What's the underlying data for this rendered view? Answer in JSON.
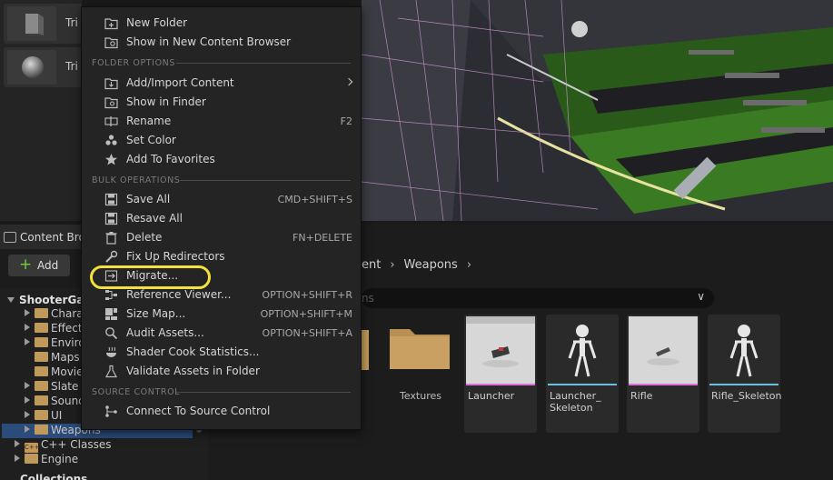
{
  "place_panel": {
    "items": [
      {
        "label": "Tri"
      },
      {
        "label": "Tri"
      }
    ]
  },
  "context_menu": {
    "items": [
      {
        "label": "New Folder",
        "icon": "new-folder-icon",
        "shortcut": ""
      },
      {
        "label": "Show in New Content Browser",
        "icon": "content-browser-icon",
        "shortcut": ""
      }
    ],
    "sections": [
      {
        "title": "FOLDER OPTIONS",
        "items": [
          {
            "label": "Add/Import Content",
            "icon": "import-icon",
            "shortcut": "",
            "submenu": true
          },
          {
            "label": "Show in Finder",
            "icon": "finder-icon",
            "shortcut": ""
          },
          {
            "label": "Rename",
            "icon": "rename-icon",
            "shortcut": "F2"
          },
          {
            "label": "Set Color",
            "icon": "palette-icon",
            "shortcut": ""
          },
          {
            "label": "Add To Favorites",
            "icon": "star-icon",
            "shortcut": ""
          }
        ]
      },
      {
        "title": "BULK OPERATIONS",
        "items": [
          {
            "label": "Save All",
            "icon": "save-icon",
            "shortcut": "CMD+SHIFT+S"
          },
          {
            "label": "Resave All",
            "icon": "save-icon",
            "shortcut": ""
          },
          {
            "label": "Delete",
            "icon": "trash-icon",
            "shortcut": "FN+DELETE"
          },
          {
            "label": "Fix Up Redirectors",
            "icon": "wrench-icon",
            "shortcut": ""
          },
          {
            "label": "Migrate...",
            "icon": "migrate-icon",
            "shortcut": ""
          },
          {
            "label": "Reference Viewer...",
            "icon": "reference-icon",
            "shortcut": "OPTION+SHIFT+R"
          },
          {
            "label": "Size Map...",
            "icon": "size-map-icon",
            "shortcut": "OPTION+SHIFT+M"
          },
          {
            "label": "Audit Assets...",
            "icon": "audit-icon",
            "shortcut": "OPTION+SHIFT+A"
          },
          {
            "label": "Shader Cook Statistics...",
            "icon": "shader-icon",
            "shortcut": ""
          },
          {
            "label": "Validate Assets in Folder",
            "icon": "flask-icon",
            "shortcut": ""
          }
        ]
      },
      {
        "title": "SOURCE CONTROL",
        "items": [
          {
            "label": "Connect To Source Control",
            "icon": "source-control-icon",
            "shortcut": ""
          }
        ]
      }
    ]
  },
  "content_browser": {
    "tab_label": "Content Bro",
    "add_label": "Add",
    "breadcrumb": [
      "ent",
      "Weapons"
    ],
    "search_placeholder": "ns",
    "tree": [
      {
        "label": "ShooterGam",
        "indent": 0,
        "kind": "root-expanded"
      },
      {
        "label": "Chara",
        "indent": 1,
        "kind": "folder-collapsed"
      },
      {
        "label": "Effect",
        "indent": 1,
        "kind": "folder-collapsed"
      },
      {
        "label": "Enviro",
        "indent": 1,
        "kind": "folder-collapsed"
      },
      {
        "label": "Maps",
        "indent": 1,
        "kind": "folder"
      },
      {
        "label": "Movie",
        "indent": 1,
        "kind": "folder"
      },
      {
        "label": "Slate",
        "indent": 1,
        "kind": "folder-collapsed"
      },
      {
        "label": "Sound",
        "indent": 1,
        "kind": "folder-collapsed"
      },
      {
        "label": "UI",
        "indent": 1,
        "kind": "folder-collapsed"
      },
      {
        "label": "Weapons",
        "indent": 1,
        "kind": "folder-selected"
      },
      {
        "label": "C++ Classes",
        "indent": 0,
        "kind": "cpp"
      },
      {
        "label": "Engine",
        "indent": 0,
        "kind": "folder-collapsed"
      }
    ],
    "collections_label": "Collections",
    "assets": [
      {
        "name": "Textures",
        "kind": "folder"
      },
      {
        "name": "Launcher",
        "kind": "mesh",
        "bar_color": "#e06fd8"
      },
      {
        "name": "Launcher_ Skeleton",
        "kind": "skeleton",
        "bar_color": "#6ac0e0"
      },
      {
        "name": "Rifle",
        "kind": "mesh",
        "bar_color": "#e06fd8"
      },
      {
        "name": "Rifle_Skeleton",
        "kind": "skeleton",
        "bar_color": "#6ac0e0"
      }
    ]
  },
  "colors": {
    "highlight_ring": "#f2e33a",
    "accent_green": "#6fcf3b",
    "folder": "#c19a5b"
  }
}
